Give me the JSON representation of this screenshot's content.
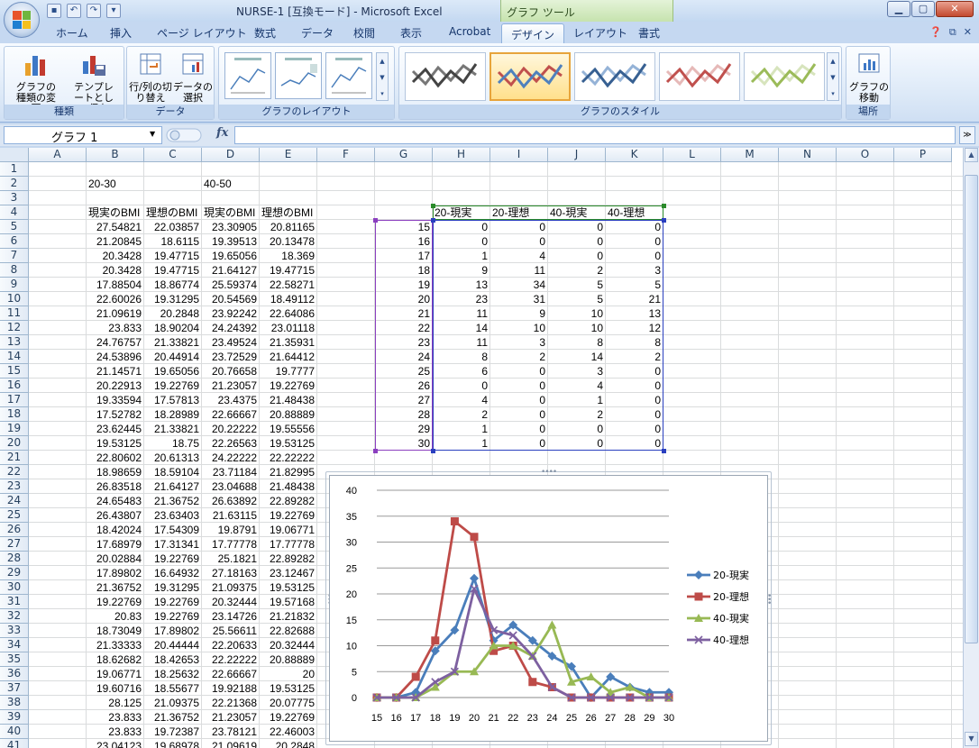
{
  "window": {
    "title": "NURSE-1  [互換モード] - Microsoft Excel",
    "tool_tab_header": "グラフ ツール"
  },
  "tabs": [
    {
      "label": "ホーム",
      "active": false
    },
    {
      "label": "挿入",
      "active": false
    },
    {
      "label": "ページ レイアウト",
      "active": false
    },
    {
      "label": "数式",
      "active": false
    },
    {
      "label": "データ",
      "active": false
    },
    {
      "label": "校閲",
      "active": false
    },
    {
      "label": "表示",
      "active": false
    },
    {
      "label": "Acrobat",
      "active": false
    },
    {
      "label": "デザイン",
      "active": true
    },
    {
      "label": "レイアウト",
      "active": false
    },
    {
      "label": "書式",
      "active": false
    }
  ],
  "ribbon": {
    "type_group": {
      "label": "種類",
      "change_type": "グラフの種類の変更",
      "save_template": "テンプレートとして保存"
    },
    "data_group": {
      "label": "データ",
      "switch_row_col": "行/列の切り替え",
      "select_data": "データの選択"
    },
    "layout_group": {
      "label": "グラフのレイアウト"
    },
    "style_group": {
      "label": "グラフのスタイル"
    },
    "location_group": {
      "label": "場所",
      "move_chart": "グラフの移動"
    }
  },
  "formula_bar": {
    "name_box": "グラフ 1",
    "fx": "fx",
    "formula": ""
  },
  "columns": [
    "A",
    "B",
    "C",
    "D",
    "E",
    "F",
    "G",
    "H",
    "I",
    "J",
    "K",
    "L",
    "M",
    "N",
    "O",
    "P"
  ],
  "rows": [
    1,
    2,
    3,
    4,
    5,
    6,
    7,
    8,
    9,
    10,
    11,
    12,
    13,
    14,
    15,
    16,
    17,
    18,
    19,
    20,
    21,
    22,
    23,
    24,
    25,
    26,
    27,
    28,
    29,
    30,
    31,
    32,
    33,
    34,
    35,
    36,
    37,
    38,
    39,
    40,
    41
  ],
  "sheet": {
    "B2": "20-30",
    "D2": "40-50",
    "headers_row4": [
      "現実のBMI",
      "理想のBMI",
      "現実のBMI",
      "理想のBMI"
    ],
    "bmi_rows": [
      [
        "27.54821",
        "22.03857",
        "23.30905",
        "20.81165"
      ],
      [
        "21.20845",
        "18.6115",
        "19.39513",
        "20.13478"
      ],
      [
        "20.3428",
        "19.47715",
        "19.65056",
        "18.369"
      ],
      [
        "20.3428",
        "19.47715",
        "21.64127",
        "19.47715"
      ],
      [
        "17.88504",
        "18.86774",
        "25.59374",
        "22.58271"
      ],
      [
        "22.60026",
        "19.31295",
        "20.54569",
        "18.49112"
      ],
      [
        "21.09619",
        "20.2848",
        "23.92242",
        "22.64086"
      ],
      [
        "23.833",
        "18.90204",
        "24.24392",
        "23.01118"
      ],
      [
        "24.76757",
        "21.33821",
        "23.49524",
        "21.35931"
      ],
      [
        "24.53896",
        "20.44914",
        "23.72529",
        "21.64412"
      ],
      [
        "21.14571",
        "19.65056",
        "20.76658",
        "19.7777"
      ],
      [
        "20.22913",
        "19.22769",
        "21.23057",
        "19.22769"
      ],
      [
        "19.33594",
        "17.57813",
        "23.4375",
        "21.48438"
      ],
      [
        "17.52782",
        "18.28989",
        "22.66667",
        "20.88889"
      ],
      [
        "23.62445",
        "21.33821",
        "20.22222",
        "19.55556"
      ],
      [
        "19.53125",
        "18.75",
        "22.26563",
        "19.53125"
      ],
      [
        "22.80602",
        "20.61313",
        "24.22222",
        "22.22222"
      ],
      [
        "18.98659",
        "18.59104",
        "23.71184",
        "21.82995"
      ],
      [
        "26.83518",
        "21.64127",
        "23.04688",
        "21.48438"
      ],
      [
        "24.65483",
        "21.36752",
        "26.63892",
        "22.89282"
      ],
      [
        "26.43807",
        "23.63403",
        "21.63115",
        "19.22769"
      ],
      [
        "18.42024",
        "17.54309",
        "19.8791",
        "19.06771"
      ],
      [
        "17.68979",
        "17.31341",
        "17.77778",
        "17.77778"
      ],
      [
        "20.02884",
        "19.22769",
        "25.1821",
        "22.89282"
      ],
      [
        "17.89802",
        "16.64932",
        "27.18163",
        "23.12467"
      ],
      [
        "21.36752",
        "19.31295",
        "21.09375",
        "19.53125"
      ],
      [
        "19.22769",
        "19.22769",
        "20.32444",
        "19.57168"
      ],
      [
        "20.83",
        "19.22769",
        "23.14726",
        "21.21832"
      ],
      [
        "18.73049",
        "17.89802",
        "25.56611",
        "22.82688"
      ],
      [
        "21.33333",
        "20.44444",
        "22.20633",
        "20.32444"
      ],
      [
        "18.62682",
        "18.42653",
        "22.22222",
        "20.88889"
      ],
      [
        "19.06771",
        "18.25632",
        "22.66667",
        "20"
      ],
      [
        "19.60716",
        "18.55677",
        "19.92188",
        "19.53125"
      ],
      [
        "28.125",
        "21.09375",
        "22.21368",
        "20.07775"
      ],
      [
        "23.833",
        "21.36752",
        "21.23057",
        "19.22769"
      ],
      [
        "23.833",
        "19.72387",
        "23.78121",
        "22.46003"
      ],
      [
        "23.04123",
        "19.68978",
        "21.09619",
        "20.2848"
      ]
    ],
    "freq_headers": [
      "20-現実",
      "20-理想",
      "40-現実",
      "40-理想"
    ],
    "freq_rows": [
      [
        15,
        0,
        0,
        0,
        0
      ],
      [
        16,
        0,
        0,
        0,
        0
      ],
      [
        17,
        1,
        4,
        0,
        0
      ],
      [
        18,
        9,
        11,
        2,
        3
      ],
      [
        19,
        13,
        34,
        5,
        5
      ],
      [
        20,
        23,
        31,
        5,
        21
      ],
      [
        21,
        11,
        9,
        10,
        13
      ],
      [
        22,
        14,
        10,
        10,
        12
      ],
      [
        23,
        11,
        3,
        8,
        8
      ],
      [
        24,
        8,
        2,
        14,
        2
      ],
      [
        25,
        6,
        0,
        3,
        0
      ],
      [
        26,
        0,
        0,
        4,
        0
      ],
      [
        27,
        4,
        0,
        1,
        0
      ],
      [
        28,
        2,
        0,
        2,
        0
      ],
      [
        29,
        1,
        0,
        0,
        0
      ],
      [
        30,
        1,
        0,
        0,
        0
      ]
    ]
  },
  "chart_data": {
    "type": "line",
    "title": "",
    "xlabel": "",
    "ylabel": "",
    "x": [
      "15",
      "16",
      "17",
      "18",
      "19",
      "20",
      "21",
      "22",
      "23",
      "24",
      "25",
      "26",
      "27",
      "28",
      "29",
      "30"
    ],
    "ylim": [
      0,
      40
    ],
    "yticks": [
      0,
      5,
      10,
      15,
      20,
      25,
      30,
      35,
      40
    ],
    "grid": true,
    "legend": "right",
    "series": [
      {
        "name": "20-現実",
        "marker": "diamond",
        "color": "#4a7ebb",
        "values": [
          0,
          0,
          1,
          9,
          13,
          23,
          11,
          14,
          11,
          8,
          6,
          0,
          4,
          2,
          1,
          1
        ]
      },
      {
        "name": "20-理想",
        "marker": "square",
        "color": "#be4b48",
        "values": [
          0,
          0,
          4,
          11,
          34,
          31,
          9,
          10,
          3,
          2,
          0,
          0,
          0,
          0,
          0,
          0
        ]
      },
      {
        "name": "40-現実",
        "marker": "triangle",
        "color": "#98b954",
        "values": [
          0,
          0,
          0,
          2,
          5,
          5,
          10,
          10,
          8,
          14,
          3,
          4,
          1,
          2,
          0,
          0
        ]
      },
      {
        "name": "40-理想",
        "marker": "x",
        "color": "#7d60a0",
        "values": [
          0,
          0,
          0,
          3,
          5,
          21,
          13,
          12,
          8,
          2,
          0,
          0,
          0,
          0,
          0,
          0
        ]
      }
    ]
  }
}
